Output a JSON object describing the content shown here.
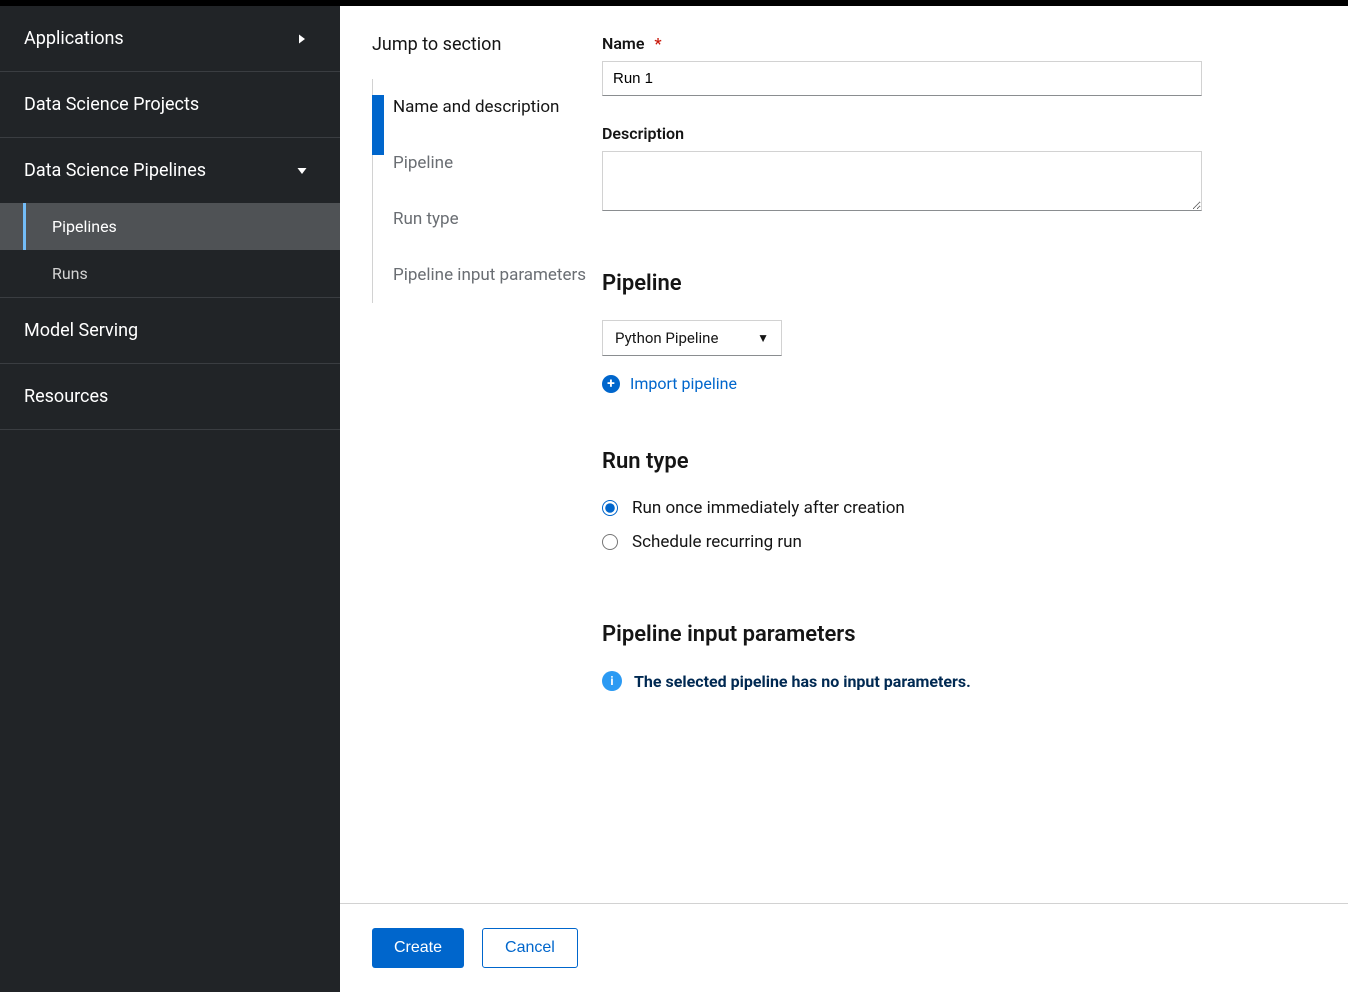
{
  "sidebar": {
    "items": [
      {
        "label": "Applications",
        "type": "expandable",
        "expanded": false
      },
      {
        "label": "Data Science Projects",
        "type": "link"
      },
      {
        "label": "Data Science Pipelines",
        "type": "expandable",
        "expanded": true,
        "children": [
          {
            "label": "Pipelines",
            "active": true
          },
          {
            "label": "Runs",
            "active": false
          }
        ]
      },
      {
        "label": "Model Serving",
        "type": "link"
      },
      {
        "label": "Resources",
        "type": "link"
      }
    ]
  },
  "jump": {
    "title": "Jump to section",
    "items": [
      "Name and description",
      "Pipeline",
      "Run type",
      "Pipeline input parameters"
    ]
  },
  "form": {
    "name_label": "Name",
    "name_value": "Run 1",
    "desc_label": "Description",
    "desc_value": "",
    "pipeline_heading": "Pipeline",
    "pipeline_selected": "Python Pipeline",
    "import_pipeline_label": "Import pipeline",
    "runtype_heading": "Run type",
    "runtype_options": [
      "Run once immediately after creation",
      "Schedule recurring run"
    ],
    "runtype_selected_index": 0,
    "params_heading": "Pipeline input parameters",
    "params_empty_msg": "The selected pipeline has no input parameters."
  },
  "footer": {
    "create_label": "Create",
    "cancel_label": "Cancel"
  }
}
